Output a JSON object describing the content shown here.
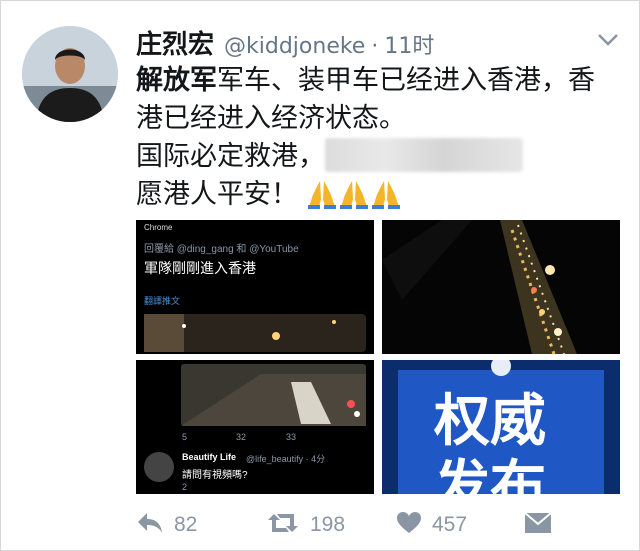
{
  "tweet": {
    "author_name": "庄烈宏",
    "handle": "@kiddjoneke",
    "separator": "·",
    "time": "11时",
    "text_line1_bold": "解放军",
    "text_line1_rest": "军车、装甲车已经进入香港，香",
    "text_line2": "港已经进入经济状态。",
    "text_line3": "国际必定救港，",
    "text_line4": "愿港人平安！"
  },
  "media": {
    "screenshot1": {
      "app_label": "Chrome",
      "reply_to": "回覆給 @ding_gang 和 @YouTube",
      "headline": "軍隊剛剛進入香港",
      "translate": "翻譯推文"
    },
    "screenshot3": {
      "count_reply": "5",
      "count_retweet": "32",
      "count_like": "33",
      "reply_user": "Beautify Life",
      "reply_handle": "@life_beautify · 4分",
      "reply_text": "請問有視頻嗎?",
      "reply_count": "2"
    },
    "screenshot4": {
      "line1": "权威",
      "line2": "发布"
    }
  },
  "actions": {
    "reply_count": "82",
    "retweet_count": "198",
    "like_count": "457"
  },
  "colors": {
    "text": "#14171a",
    "muted": "#657786",
    "action": "#8a96a3",
    "emoji": "#f5b52b",
    "banner_blue": "#0a2a6a"
  }
}
